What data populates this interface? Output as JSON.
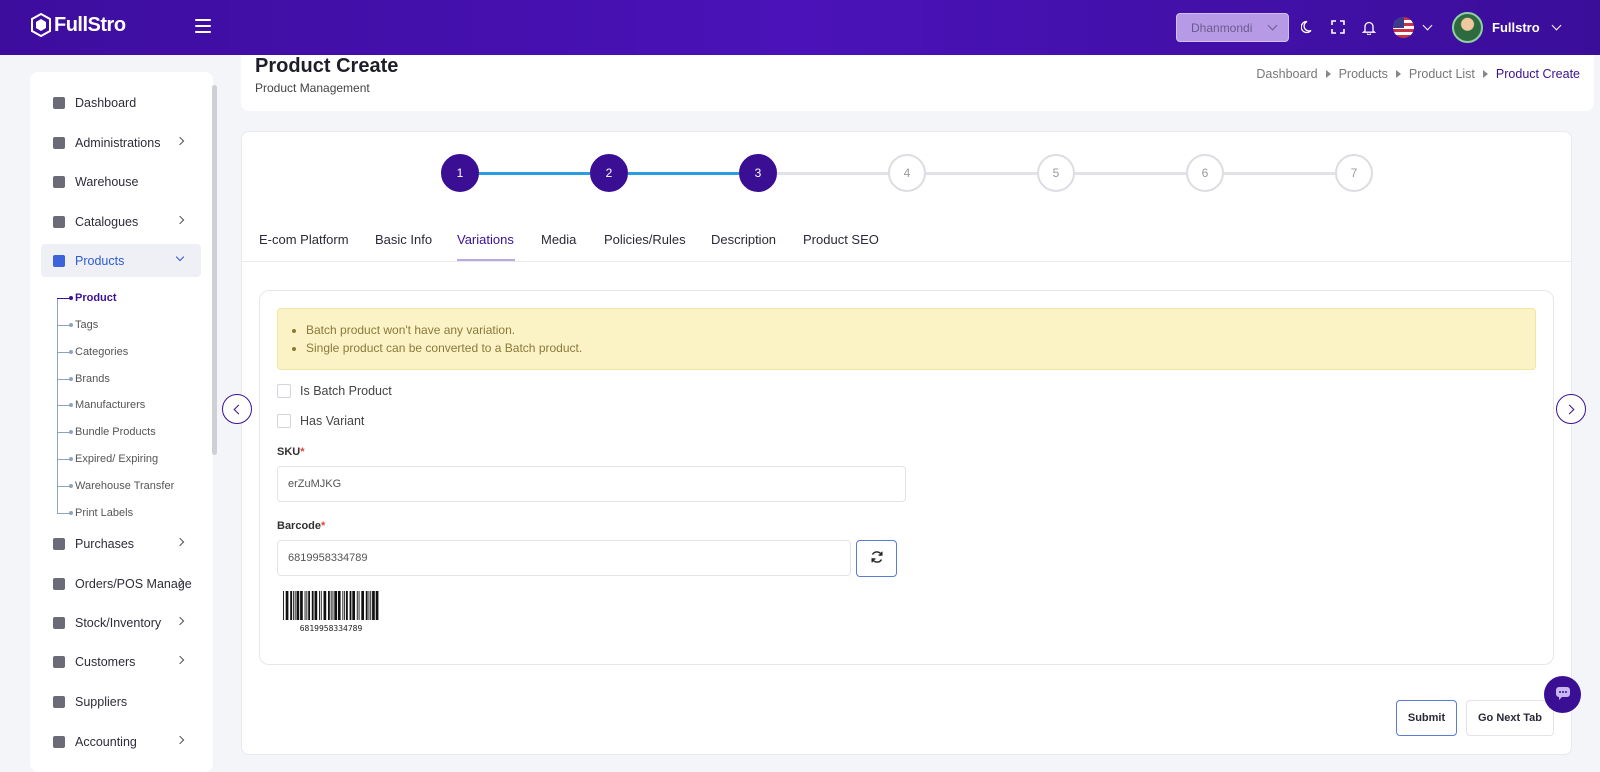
{
  "topbar": {
    "brand": "FullStro",
    "branch": "Dhanmondi",
    "user_name": "Fullstro"
  },
  "sidebar": {
    "items": [
      {
        "label": "Dashboard"
      },
      {
        "label": "Administrations"
      },
      {
        "label": "Warehouse"
      },
      {
        "label": "Catalogues"
      },
      {
        "label": "Products"
      },
      {
        "label": "Purchases"
      },
      {
        "label": "Orders/POS Manage"
      },
      {
        "label": "Stock/Inventory"
      },
      {
        "label": "Customers"
      },
      {
        "label": "Suppliers"
      },
      {
        "label": "Accounting"
      }
    ],
    "product_sub": [
      {
        "label": "Product"
      },
      {
        "label": "Tags"
      },
      {
        "label": "Categories"
      },
      {
        "label": "Brands"
      },
      {
        "label": "Manufacturers"
      },
      {
        "label": "Bundle Products"
      },
      {
        "label": "Expired/ Expiring"
      },
      {
        "label": "Warehouse Transfer"
      },
      {
        "label": "Print Labels"
      }
    ]
  },
  "header": {
    "title": "Product Create",
    "subtitle": "Product Management",
    "breadcrumb": [
      "Dashboard",
      "Products",
      "Product List",
      "Product Create"
    ]
  },
  "stepper": {
    "steps": [
      "1",
      "2",
      "3",
      "4",
      "5",
      "6",
      "7"
    ],
    "current": 3
  },
  "tabs": [
    "E-com Platform",
    "Basic Info",
    "Variations",
    "Media",
    "Policies/Rules",
    "Description",
    "Product SEO"
  ],
  "alert": [
    "Batch product won't have any variation.",
    "Single product can be converted to a Batch product."
  ],
  "form": {
    "is_batch_label": "Is Batch Product",
    "has_variant_label": "Has Variant",
    "sku_label": "SKU",
    "sku_value": "erZuMJKG",
    "barcode_label": "Barcode",
    "barcode_value": "6819958334789",
    "required_mark": "*"
  },
  "actions": {
    "submit": "Submit",
    "next_tab": "Go Next Tab"
  }
}
